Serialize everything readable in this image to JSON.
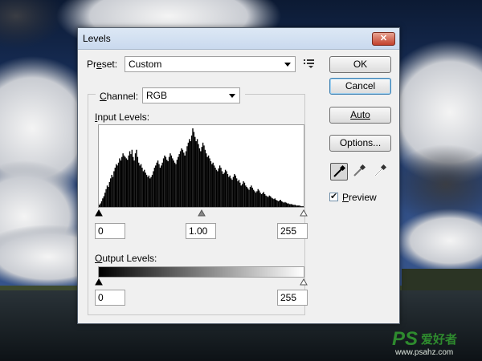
{
  "dialog": {
    "title": "Levels",
    "close_label": "✕"
  },
  "preset": {
    "label_prefix": "Pr",
    "label_mnemonic": "e",
    "label_suffix": "set:",
    "value": "Custom",
    "menu_icon": "preset-options-icon"
  },
  "channel": {
    "label_mnemonic": "C",
    "label_suffix": "hannel:",
    "value": "RGB"
  },
  "input_levels": {
    "label_mnemonic": "I",
    "label_suffix": "nput Levels:",
    "black": "0",
    "gray": "1.00",
    "white": "255"
  },
  "output_levels": {
    "label_mnemonic": "O",
    "label_suffix": "utput Levels:",
    "black": "0",
    "white": "255"
  },
  "buttons": {
    "ok": "OK",
    "cancel": "Cancel",
    "auto": "Auto",
    "options": "Options..."
  },
  "eyedroppers": [
    "black-point-eyedropper-icon",
    "gray-point-eyedropper-icon",
    "white-point-eyedropper-icon"
  ],
  "preview": {
    "label_mnemonic": "P",
    "label_suffix": "review",
    "checked": true
  },
  "watermark": {
    "brand": "PS",
    "cn": "爱好者",
    "url": "www.psahz.com"
  },
  "colors": {
    "accent": "#3c7fb1",
    "watermark_green": "#2e8b2e",
    "close_red": "#c2412c"
  },
  "histogram": {
    "channel": "RGB",
    "levels": [
      3,
      5,
      8,
      12,
      15,
      20,
      25,
      30,
      28,
      35,
      40,
      45,
      42,
      50,
      55,
      60,
      58,
      62,
      68,
      65,
      70,
      75,
      72,
      70,
      68,
      66,
      72,
      78,
      74,
      80,
      70,
      65,
      75,
      80,
      70,
      62,
      58,
      60,
      55,
      50,
      52,
      48,
      45,
      42,
      44,
      40,
      42,
      45,
      50,
      55,
      58,
      62,
      65,
      60,
      55,
      58,
      62,
      68,
      72,
      70,
      66,
      64,
      70,
      75,
      72,
      68,
      65,
      62,
      60,
      66,
      70,
      74,
      78,
      82,
      80,
      76,
      72,
      78,
      85,
      90,
      95,
      92,
      100,
      110,
      105,
      98,
      92,
      95,
      88,
      82,
      78,
      84,
      90,
      86,
      80,
      75,
      70,
      72,
      68,
      64,
      60,
      62,
      58,
      55,
      52,
      50,
      54,
      58,
      55,
      50,
      46,
      48,
      52,
      50,
      46,
      42,
      44,
      40,
      38,
      42,
      46,
      44,
      40,
      36,
      38,
      34,
      30,
      32,
      36,
      34,
      30,
      28,
      26,
      24,
      28,
      30,
      27,
      24,
      22,
      20,
      22,
      25,
      23,
      20,
      18,
      19,
      21,
      18,
      16,
      15,
      14,
      16,
      15,
      13,
      12,
      11,
      12,
      10,
      9,
      8,
      9,
      10,
      8,
      7,
      6,
      7,
      6,
      5,
      5,
      4,
      4,
      4,
      3,
      3,
      3,
      2,
      2,
      2,
      2,
      1,
      1,
      1
    ]
  }
}
